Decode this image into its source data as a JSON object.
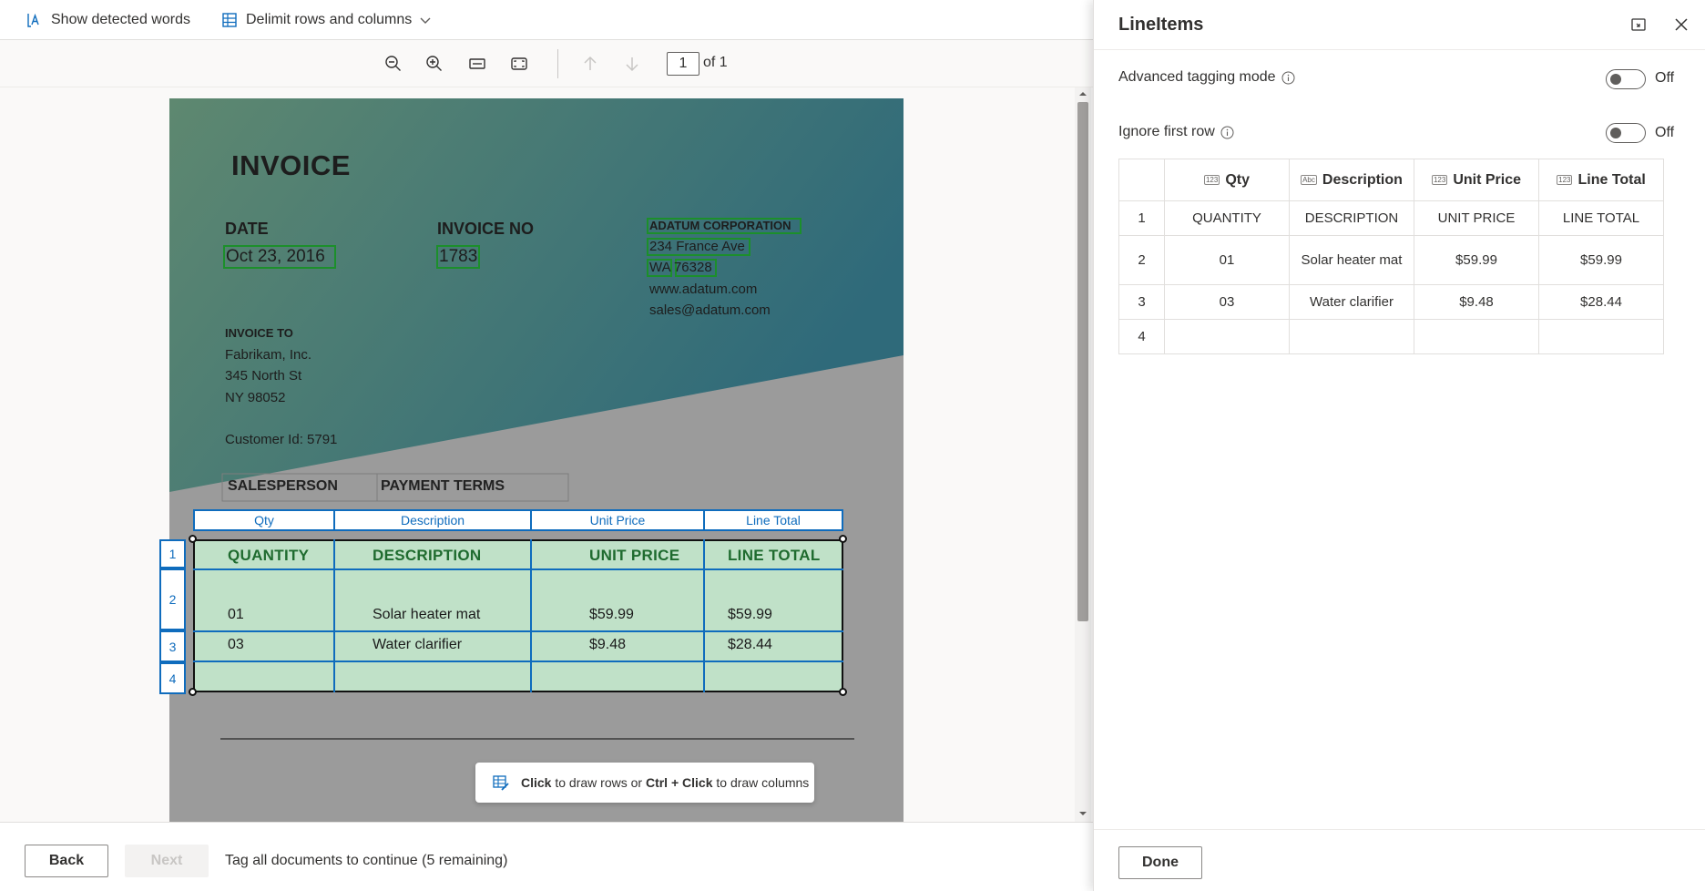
{
  "toolbar": {
    "show_words": "Show detected words",
    "delimit": "Delimit rows and columns"
  },
  "viewer": {
    "page_current": "1",
    "page_of": "of 1"
  },
  "document": {
    "title": "INVOICE",
    "date_label": "DATE",
    "date_value": "Oct 23, 2016",
    "invoice_no_label": "INVOICE NO",
    "invoice_no_value": "1783",
    "company_name": "ADATUM CORPORATION",
    "company_addr1": "234 France Ave",
    "company_addr2": "WA 76328",
    "company_web": "www.adatum.com",
    "company_email": "sales@adatum.com",
    "invoice_to_label": "INVOICE TO",
    "invoice_to_name": "Fabrikam, Inc.",
    "invoice_to_addr1": "345 North St",
    "invoice_to_addr2": "NY 98052",
    "customer_id": "Customer Id: 5791",
    "salesperson_label": "SALESPERSON",
    "payment_terms_label": "PAYMENT TERMS",
    "table_headers": [
      "QUANTITY",
      "DESCRIPTION",
      "UNIT PRICE",
      "LINE TOTAL"
    ],
    "row1": [
      "01",
      "Solar heater mat",
      "$59.99",
      "$59.99"
    ],
    "row2": [
      "03",
      "Water clarifier",
      "$9.48",
      "$28.44"
    ]
  },
  "overlay": {
    "columns": [
      "Qty",
      "Description",
      "Unit Price",
      "Line Total"
    ],
    "rows": [
      "1",
      "2",
      "3",
      "4"
    ]
  },
  "hint": {
    "click": "Click",
    "rows": " to draw rows or ",
    "ctrl_click": "Ctrl + Click",
    "columns": " to draw columns"
  },
  "footer": {
    "back": "Back",
    "next": "Next",
    "status": "Tag all documents to continue (5 remaining)"
  },
  "panel": {
    "title": "LineItems",
    "advanced_tagging": "Advanced tagging mode",
    "advanced_state": "Off",
    "ignore_first_row": "Ignore first row",
    "ignore_state": "Off",
    "type_icon_num": "123",
    "type_icon_abc": "Abc",
    "columns": [
      "Qty",
      "Description",
      "Unit Price",
      "Line Total"
    ],
    "rows": [
      {
        "n": "1",
        "cells": [
          "QUANTITY",
          "DESCRIPTION",
          "UNIT PRICE",
          "LINE TOTAL"
        ]
      },
      {
        "n": "2",
        "cells": [
          "01",
          "Solar heater mat",
          "$59.99",
          "$59.99"
        ]
      },
      {
        "n": "3",
        "cells": [
          "03",
          "Water clarifier",
          "$9.48",
          "$28.44"
        ]
      },
      {
        "n": "4",
        "cells": [
          "",
          "",
          "",
          ""
        ]
      }
    ],
    "done": "Done"
  },
  "colors": {
    "accent": "#0f6cbd",
    "detected": "#1c8f2b",
    "header_green": "#1f6b2f"
  }
}
